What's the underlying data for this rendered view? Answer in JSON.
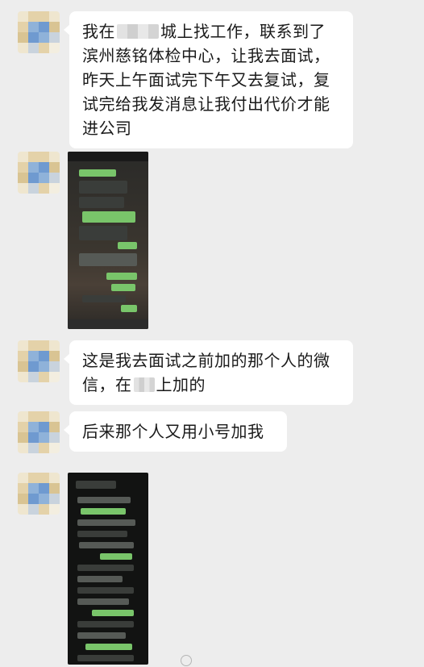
{
  "colors": {
    "chat_background": "#ededed",
    "bubble_background": "#ffffff",
    "text": "#1a1a1a",
    "screenshot_green_bubble": "#79c56a"
  },
  "messages": [
    {
      "type": "text",
      "sender": "other",
      "lines": [
        {
          "prefix": "我在",
          "redacted": true,
          "suffix": "城上找工作，联系到了"
        },
        {
          "text": "滨州慈铭体检中心，让我去面试，"
        },
        {
          "text": "昨天上午面试完下午又去复试，复"
        },
        {
          "text": "试完给我发消息让我付出代价才能"
        },
        {
          "text": "进公司"
        }
      ]
    },
    {
      "type": "image",
      "sender": "other",
      "description_icon": "chat-screenshot-image"
    },
    {
      "type": "text",
      "sender": "other",
      "lines": [
        {
          "text": "这是我去面试之前加的那个人的微"
        },
        {
          "prefix": "信，在",
          "redacted": true,
          "suffix": "上加的"
        }
      ]
    },
    {
      "type": "text",
      "sender": "other",
      "lines": [
        {
          "text": "后来那个人又用小号加我"
        }
      ]
    },
    {
      "type": "image",
      "sender": "other",
      "description_icon": "chat-screenshot-image"
    }
  ],
  "watermark": {
    "icon": "weibo-icon"
  }
}
